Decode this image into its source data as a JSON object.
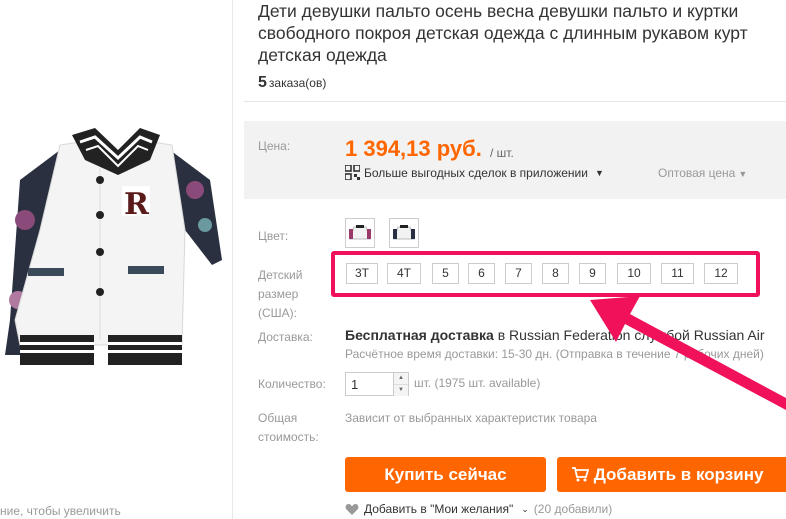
{
  "gallery": {
    "zoom_hint": "ние, чтобы увеличить"
  },
  "product": {
    "title_lines": [
      "Дети девушки пальто осень весна девушки пальто и куртки",
      "свободного покроя детская одежда с длинным рукавом курт",
      "детская одежда"
    ],
    "orders_count": "5",
    "orders_label": "заказа(ов)"
  },
  "price": {
    "label": "Цена:",
    "value": "1 394,13 руб.",
    "unit": "/ шт.",
    "app_deal": "Больше выгодных сделок в приложении",
    "wholesale": "Оптовая цена"
  },
  "color": {
    "label": "Цвет:"
  },
  "size": {
    "label_lines": [
      "Детский",
      "размер",
      "(США):"
    ],
    "options": [
      "3T",
      "4T",
      "5",
      "6",
      "7",
      "8",
      "9",
      "10",
      "11",
      "12"
    ]
  },
  "shipping": {
    "label": "Доставка:",
    "free": "Бесплатная доставка",
    "to": "в",
    "destination": "Russian Federation",
    "via": "службой Russian Air",
    "estimate": "Расчётное время доставки: 15-30 дн. (Отправка в течение 7 рабочих дней)"
  },
  "quantity": {
    "label": "Количество:",
    "value": "1",
    "available": "шт. (1975 шт. available)"
  },
  "total": {
    "label_lines": [
      "Общая",
      "стоимость:"
    ],
    "text": "Зависит от выбранных характеристик товара"
  },
  "actions": {
    "buy_now": "Купить сейчас",
    "add_to_cart": "Добавить в корзину",
    "wishlist": "Добавить в \"Мои желания\"",
    "wishlist_count": "(20 добавили)"
  },
  "colors": {
    "accent": "#ff6600",
    "highlight": "#f0115a"
  }
}
